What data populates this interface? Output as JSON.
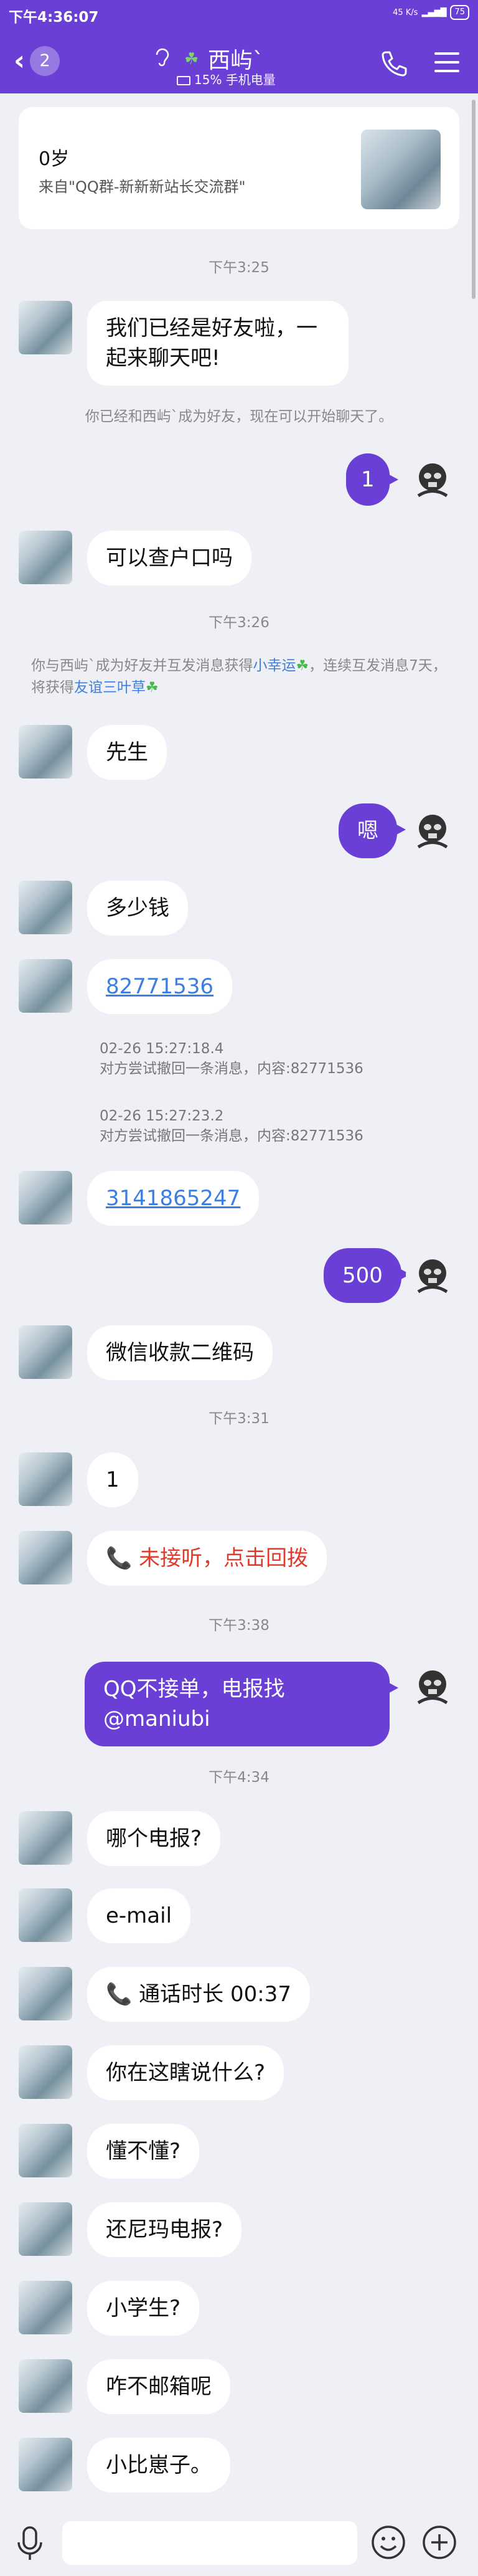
{
  "status_bar": {
    "time": "下午4:36:07",
    "speed": "45 K/s",
    "battery": "75"
  },
  "header": {
    "unread_count": "2",
    "contact_name": "西屿`",
    "online_status": "15% 手机电量"
  },
  "group_card": {
    "age": "0岁",
    "source": "来自\"QQ群-新新新站长交流群\""
  },
  "messages": {
    "t1": "下午3:25",
    "m1": "我们已经是好友啦，一起来聊天吧!",
    "sys1": "你已经和西屿`成为好友，现在可以开始聊天了。",
    "r1": "1",
    "m2": "可以查户口吗",
    "t2": "下午3:26",
    "sys2_a": "你与西屿`成为好友并互发消息获得",
    "sys2_link1": "小幸运",
    "sys2_b": "，连续互发消息7天，将获得",
    "sys2_link2": "友谊三叶草",
    "m3": "先生",
    "r2": "嗯",
    "m4": "多少钱",
    "m5": "82771536",
    "recall1_time": "02-26 15:27:18.4",
    "recall1_text": "对方尝试撤回一条消息，内容:82771536",
    "recall2_time": "02-26 15:27:23.2",
    "recall2_text": "对方尝试撤回一条消息，内容:82771536",
    "m6": "3141865247",
    "r3": "500",
    "m7": "微信收款二维码",
    "t3": "下午3:31",
    "m8": "1",
    "m9": "未接听，点击回拨",
    "t4": "下午3:38",
    "r4": "QQ不接单，电报找@maniubi",
    "t5": "下午4:34",
    "m10": "哪个电报?",
    "m11": "e-mail",
    "m12": "通话时长 00:37",
    "m13": "你在这瞎说什么?",
    "m14": "懂不懂?",
    "m15": "还尼玛电报?",
    "m16": "小学生?",
    "m17": "咋不邮箱呢",
    "m18": "小比崽子。"
  },
  "input": {
    "placeholder": ""
  },
  "colors": {
    "accent": "#6a3fd6",
    "link": "#3c7fe0",
    "missed": "#e23b2b"
  },
  "icons": [
    "back-icon",
    "ear-icon",
    "clover-icon",
    "phone-icon",
    "menu-icon",
    "mic-icon",
    "emoji-icon",
    "plus-icon"
  ]
}
